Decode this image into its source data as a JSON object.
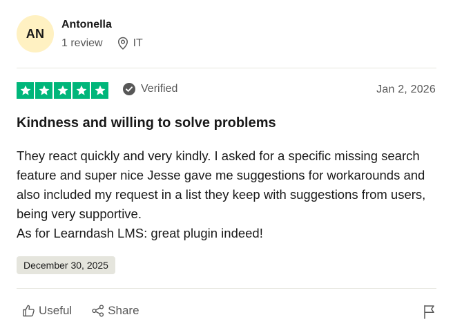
{
  "reviewer": {
    "initials": "AN",
    "name": "Antonella",
    "review_count": "1 review",
    "country": "IT"
  },
  "rating": {
    "stars": 5,
    "max_stars": 5,
    "star_color": "#00b67a",
    "verified_label": "Verified"
  },
  "review": {
    "date": "Jan 2, 2026",
    "title": "Kindness and willing to solve problems",
    "body_lines": [
      "They react quickly and very kindly. I asked for a specific missing search feature and super nice Jesse gave me suggestions for workarounds and also included my request in a list they keep with suggestions from users, being very supportive.",
      "As for Learndash LMS: great plugin indeed!"
    ],
    "experience_date": "December 30, 2025"
  },
  "actions": {
    "useful_label": "Useful",
    "share_label": "Share",
    "icons": [
      "thumbs-up-icon",
      "share-icon",
      "flag-icon"
    ]
  },
  "colors": {
    "avatar_bg": "#fff1c2",
    "muted_text": "#575757",
    "divider": "#e5e5dd"
  }
}
